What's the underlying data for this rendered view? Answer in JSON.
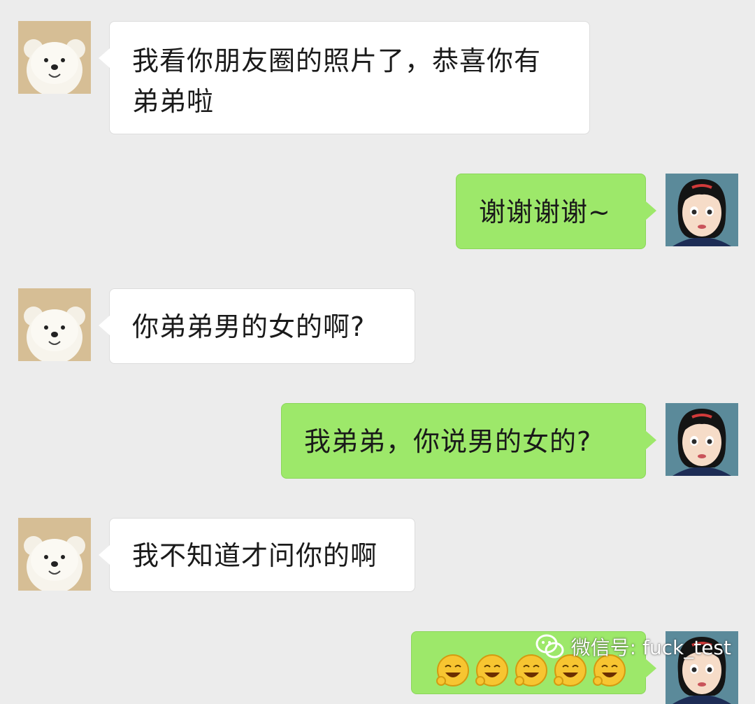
{
  "messages": [
    {
      "side": "in",
      "text": "我看你朋友圈的照片了，恭喜你有\n弟弟啦"
    },
    {
      "side": "out",
      "text": "谢谢谢谢~"
    },
    {
      "side": "in",
      "text": "你弟弟男的女的啊?"
    },
    {
      "side": "out",
      "text": "我弟弟，你说男的女的?"
    },
    {
      "side": "in",
      "text": "我不知道才问你的啊"
    },
    {
      "side": "out",
      "emoji": [
        "laugh-emoji",
        "laugh-emoji",
        "laugh-emoji",
        "laugh-emoji",
        "laugh-emoji"
      ]
    }
  ],
  "avatars": {
    "incoming": "teddy-bear-avatar",
    "outgoing": "cartoon-girl-avatar"
  },
  "watermark": {
    "icon": "wechat-icon",
    "text": "微信号: fuck_test"
  },
  "colors": {
    "background": "#ececec",
    "incoming_bubble": "#ffffff",
    "outgoing_bubble": "#9de86a"
  }
}
